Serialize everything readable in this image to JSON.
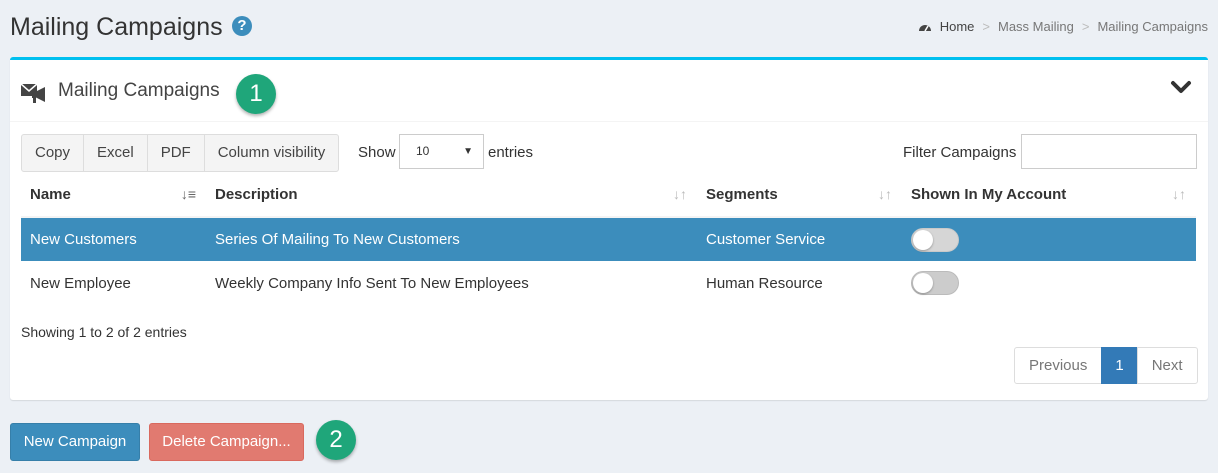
{
  "header": {
    "title": "Mailing Campaigns",
    "help_glyph": "?",
    "breadcrumb": {
      "home": "Home",
      "section": "Mass Mailing",
      "current": "Mailing Campaigns",
      "separator": ">"
    }
  },
  "box": {
    "title": "Mailing Campaigns",
    "callout_1": "1",
    "icons": {
      "title_icon": "megaphone-icon",
      "collapse_icon": "chevron-down-icon"
    },
    "accent_color": "#00c0ef"
  },
  "toolbar": {
    "buttons": [
      "Copy",
      "Excel",
      "PDF",
      "Column visibility"
    ],
    "show_label": "Show",
    "page_size": "10",
    "entries_label": "entries",
    "filter_label": "Filter Campaigns",
    "filter_value": ""
  },
  "table": {
    "columns": [
      "Name",
      "Description",
      "Segments",
      "Shown In My Account"
    ],
    "rows": [
      {
        "name": "New Customers",
        "description": "Series Of Mailing To New Customers",
        "segments": "Customer Service",
        "shown": false,
        "selected": true
      },
      {
        "name": "New Employee",
        "description": "Weekly Company Info Sent To New Employees",
        "segments": "Human Resource",
        "shown": false,
        "selected": false
      }
    ],
    "selected_row_color": "#3c8dbc"
  },
  "footer": {
    "info": "Showing 1 to 2 of 2 entries",
    "pagination": {
      "previous": "Previous",
      "current": "1",
      "next": "Next"
    }
  },
  "actions": {
    "new_label": "New Campaign",
    "delete_label": "Delete Campaign...",
    "callout_2": "2",
    "new_color": "#3c8dbc",
    "delete_color": "#e17a70"
  }
}
